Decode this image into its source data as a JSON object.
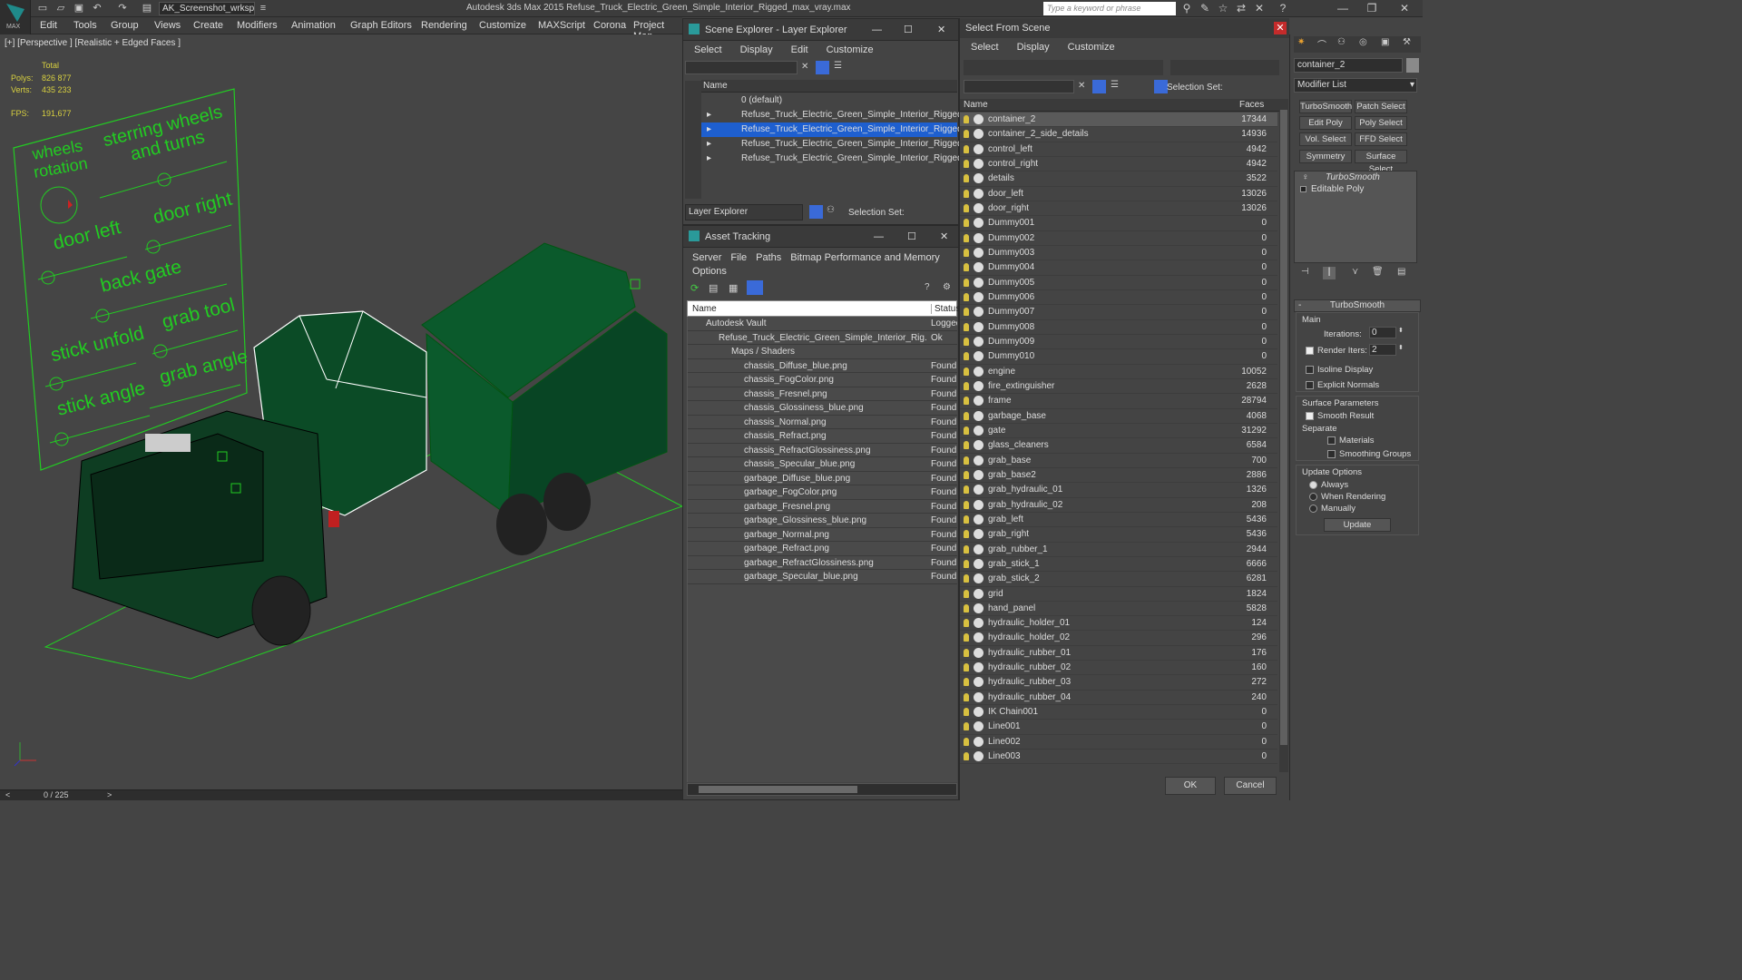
{
  "app": {
    "workspace": "AK_Screenshot_wrksp",
    "title": "Autodesk 3ds Max  2015     Refuse_Truck_Electric_Green_Simple_Interior_Rigged_max_vray.max",
    "search_placeholder": "Type a keyword or phrase",
    "logo_text": "MAX"
  },
  "menu": [
    "Edit",
    "Tools",
    "Group",
    "Views",
    "Create",
    "Modifiers",
    "Animation",
    "Graph Editors",
    "Rendering",
    "Customize",
    "MAXScript",
    "Corona",
    "Project Man"
  ],
  "viewport": {
    "label": "[+] [Perspective ] [Realistic + Edged Faces ]",
    "stats": {
      "total_label": "Total",
      "polys_label": "Polys:",
      "polys": "826 877",
      "verts_label": "Verts:",
      "verts": "435 233",
      "fps_label": "FPS:",
      "fps": "191,677"
    },
    "rig_labels": [
      "wheels rotation",
      "sterring wheels and turns",
      "door left",
      "door right",
      "back gate",
      "stick unfold",
      "grab tool",
      "stick angle",
      "grab angle"
    ],
    "timeline": "0 / 225",
    "timeline_next": ">"
  },
  "scene_explorer": {
    "title": "Scene Explorer - Layer Explorer",
    "menu": [
      "Select",
      "Display",
      "Edit",
      "Customize"
    ],
    "column": "Name",
    "layers": [
      {
        "name": "0 (default)",
        "selected": false,
        "expandable": false
      },
      {
        "name": "Refuse_Truck_Electric_Green_Simple_Interior_Rigged_bo...",
        "selected": false,
        "expandable": true
      },
      {
        "name": "Refuse_Truck_Electric_Green_Simple_Interior_Rigged",
        "selected": true,
        "expandable": true
      },
      {
        "name": "Refuse_Truck_Electric_Green_Simple_Interior_Rigged_he...",
        "selected": false,
        "expandable": true
      },
      {
        "name": "Refuse_Truck_Electric_Green_Simple_Interior_Rigged_co...",
        "selected": false,
        "expandable": true
      }
    ],
    "footer_label": "Layer Explorer",
    "selection_set": "Selection Set:"
  },
  "asset_tracking": {
    "title": "Asset Tracking",
    "menu": [
      "Server",
      "File",
      "Paths",
      "Bitmap Performance and Memory",
      "Options"
    ],
    "col_name": "Name",
    "col_status": "Status",
    "rows": [
      {
        "name": "Autodesk Vault",
        "status": "Logged",
        "indent": 0
      },
      {
        "name": "Refuse_Truck_Electric_Green_Simple_Interior_Rig...",
        "status": "Ok",
        "indent": 1
      },
      {
        "name": "Maps / Shaders",
        "status": "",
        "indent": 2
      },
      {
        "name": "chassis_Diffuse_blue.png",
        "status": "Found",
        "indent": 3
      },
      {
        "name": "chassis_FogColor.png",
        "status": "Found",
        "indent": 3
      },
      {
        "name": "chassis_Fresnel.png",
        "status": "Found",
        "indent": 3
      },
      {
        "name": "chassis_Glossiness_blue.png",
        "status": "Found",
        "indent": 3
      },
      {
        "name": "chassis_Normal.png",
        "status": "Found",
        "indent": 3
      },
      {
        "name": "chassis_Refract.png",
        "status": "Found",
        "indent": 3
      },
      {
        "name": "chassis_RefractGlossiness.png",
        "status": "Found",
        "indent": 3
      },
      {
        "name": "chassis_Specular_blue.png",
        "status": "Found",
        "indent": 3
      },
      {
        "name": "garbage_Diffuse_blue.png",
        "status": "Found",
        "indent": 3
      },
      {
        "name": "garbage_FogColor.png",
        "status": "Found",
        "indent": 3
      },
      {
        "name": "garbage_Fresnel.png",
        "status": "Found",
        "indent": 3
      },
      {
        "name": "garbage_Glossiness_blue.png",
        "status": "Found",
        "indent": 3
      },
      {
        "name": "garbage_Normal.png",
        "status": "Found",
        "indent": 3
      },
      {
        "name": "garbage_Refract.png",
        "status": "Found",
        "indent": 3
      },
      {
        "name": "garbage_RefractGlossiness.png",
        "status": "Found",
        "indent": 3
      },
      {
        "name": "garbage_Specular_blue.png",
        "status": "Found",
        "indent": 3
      }
    ]
  },
  "select_from_scene": {
    "title": "Select From Scene",
    "menu": [
      "Select",
      "Display",
      "Customize"
    ],
    "selection_set": "Selection Set:",
    "col_name": "Name",
    "col_faces": "Faces",
    "rows": [
      [
        "container_2",
        "17344"
      ],
      [
        "container_2_side_details",
        "14936"
      ],
      [
        "control_left",
        "4942"
      ],
      [
        "control_right",
        "4942"
      ],
      [
        "details",
        "3522"
      ],
      [
        "door_left",
        "13026"
      ],
      [
        "door_right",
        "13026"
      ],
      [
        "Dummy001",
        "0"
      ],
      [
        "Dummy002",
        "0"
      ],
      [
        "Dummy003",
        "0"
      ],
      [
        "Dummy004",
        "0"
      ],
      [
        "Dummy005",
        "0"
      ],
      [
        "Dummy006",
        "0"
      ],
      [
        "Dummy007",
        "0"
      ],
      [
        "Dummy008",
        "0"
      ],
      [
        "Dummy009",
        "0"
      ],
      [
        "Dummy010",
        "0"
      ],
      [
        "engine",
        "10052"
      ],
      [
        "fire_extinguisher",
        "2628"
      ],
      [
        "frame",
        "28794"
      ],
      [
        "garbage_base",
        "4068"
      ],
      [
        "gate",
        "31292"
      ],
      [
        "glass_cleaners",
        "6584"
      ],
      [
        "grab_base",
        "700"
      ],
      [
        "grab_base2",
        "2886"
      ],
      [
        "grab_hydraulic_01",
        "1326"
      ],
      [
        "grab_hydraulic_02",
        "208"
      ],
      [
        "grab_left",
        "5436"
      ],
      [
        "grab_right",
        "5436"
      ],
      [
        "grab_rubber_1",
        "2944"
      ],
      [
        "grab_stick_1",
        "6666"
      ],
      [
        "grab_stick_2",
        "6281"
      ],
      [
        "grid",
        "1824"
      ],
      [
        "hand_panel",
        "5828"
      ],
      [
        "hydraulic_holder_01",
        "124"
      ],
      [
        "hydraulic_holder_02",
        "296"
      ],
      [
        "hydraulic_rubber_01",
        "176"
      ],
      [
        "hydraulic_rubber_02",
        "160"
      ],
      [
        "hydraulic_rubber_03",
        "272"
      ],
      [
        "hydraulic_rubber_04",
        "240"
      ],
      [
        "IK Chain001",
        "0"
      ],
      [
        "Line001",
        "0"
      ],
      [
        "Line002",
        "0"
      ],
      [
        "Line003",
        "0"
      ]
    ],
    "ok": "OK",
    "cancel": "Cancel"
  },
  "command_panel": {
    "object_name": "container_2",
    "modifier_list": "Modifier List",
    "mod_buttons": [
      "TurboSmooth",
      "Patch Select",
      "Edit Poly",
      "Poly Select",
      "Vol. Select",
      "FFD Select",
      "Symmetry",
      "Surface Select"
    ],
    "stack": [
      "TurboSmooth",
      "Editable Poly"
    ],
    "rollout_title": "TurboSmooth",
    "main_label": "Main",
    "iterations_label": "Iterations:",
    "iterations": "0",
    "render_iters_label": "Render Iters:",
    "render_iters": "2",
    "isoline": "Isoline Display",
    "explicit": "Explicit Normals",
    "surface_params": "Surface Parameters",
    "smooth_result": "Smooth Result",
    "separate": "Separate",
    "materials": "Materials",
    "smoothing_groups": "Smoothing Groups",
    "update_options": "Update Options",
    "always": "Always",
    "when_rendering": "When Rendering",
    "manually": "Manually",
    "update": "Update"
  },
  "colors": {
    "rig_green": "#22cc22",
    "truck_green": "#0b5a2c",
    "selection_blue": "#1e5fcf"
  }
}
